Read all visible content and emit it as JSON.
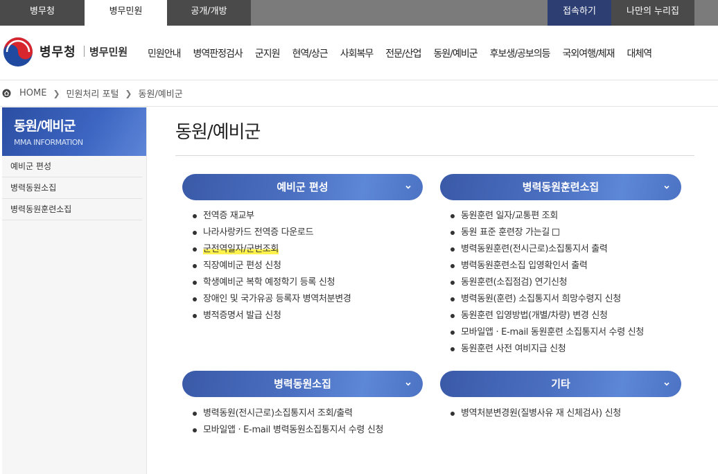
{
  "topbar": {
    "tabs": [
      "병무청",
      "병무민원",
      "공개/개방"
    ],
    "login": "접속하기",
    "my": "나만의 누리집"
  },
  "header": {
    "brand": "병무청",
    "brand_sub": "병무민원",
    "gnb": [
      "민원안내",
      "병역판정검사",
      "군지원",
      "현역/상근",
      "사회복무",
      "전문/산업",
      "동원/예비군",
      "후보생/공보의등",
      "국외여행/체재",
      "대체역"
    ]
  },
  "breadcrumb": [
    "HOME",
    "민원처리 포털",
    "동원/예비군"
  ],
  "sidebar": {
    "title": "동원/예비군",
    "subtitle": "MMA INFORMATION",
    "items": [
      "예비군 편성",
      "병력동원소집",
      "병력동원훈련소집"
    ]
  },
  "main": {
    "title": "동원/예비군",
    "sections": [
      {
        "title": "예비군 편성",
        "items": [
          "전역증 재교부",
          "나라사랑카드 전역증 다운로드",
          "군전역일자/군번조회",
          "직장예비군 편성 신청",
          "학생예비군 복학 예정학기 등록 신청",
          "장애인 및 국가유공 등록자 병역처분변경",
          "병적증명서 발급 신청"
        ]
      },
      {
        "title": "병력동원훈련소집",
        "items": [
          "동원훈련 일자/교통편 조회",
          "동원 표준 훈련장 가는길",
          "병력동원훈련(전시근로)소집통지서 출력",
          "병력동원훈련소집 입영확인서 출력",
          "동원훈련(소집점검) 연기신청",
          "병력동원(훈련) 소집통지서 희망수령지 신청",
          "동원훈련 입영방법(개별/차량) 변경 신청",
          "모바일앱 · E-mail 동원훈련 소집통지서 수령 신청",
          "동원훈련 사전 여비지급 신청"
        ]
      },
      {
        "title": "병력동원소집",
        "items": [
          "병력동원(전시근로)소집통지서 조회/출력",
          "모바일앱 · E-mail 병력동원소집통지서 수령 신청"
        ]
      },
      {
        "title": "기타",
        "items": [
          "병역처분변경원(질병사유 재 신체검사) 신청"
        ]
      }
    ]
  }
}
